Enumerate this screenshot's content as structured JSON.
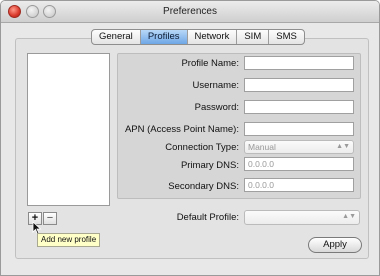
{
  "window": {
    "title": "Preferences"
  },
  "tabs": [
    {
      "label": "General",
      "active": false
    },
    {
      "label": "Profiles",
      "active": true
    },
    {
      "label": "Network",
      "active": false
    },
    {
      "label": "SIM",
      "active": false
    },
    {
      "label": "SMS",
      "active": false
    }
  ],
  "form": {
    "profile_name": {
      "label": "Profile Name:",
      "value": ""
    },
    "username": {
      "label": "Username:",
      "value": ""
    },
    "password": {
      "label": "Password:",
      "value": ""
    },
    "apn": {
      "label": "APN (Access Point Name):",
      "value": ""
    },
    "connection_type": {
      "label": "Connection Type:",
      "value": "Manual"
    },
    "primary_dns": {
      "label": "Primary DNS:",
      "placeholder": "0.0.0.0"
    },
    "secondary_dns": {
      "label": "Secondary DNS:",
      "placeholder": "0.0.0.0"
    }
  },
  "list_controls": {
    "add": "+",
    "remove": "−",
    "tooltip": "Add new profile"
  },
  "default_profile": {
    "label": "Default Profile:",
    "value": ""
  },
  "buttons": {
    "apply": "Apply"
  },
  "icons": {
    "stepper": "up-down-arrows-icon"
  }
}
